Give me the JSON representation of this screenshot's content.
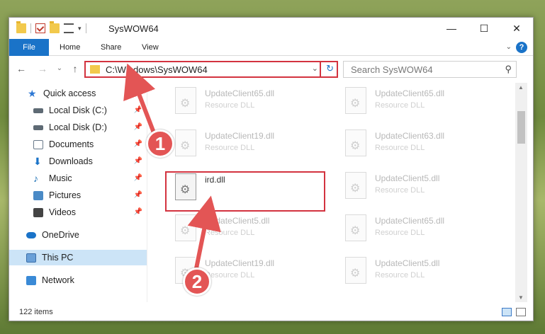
{
  "window": {
    "title": "SysWOW64",
    "minimize": "—",
    "maximize": "☐",
    "close": "✕"
  },
  "ribbon": {
    "tabs": [
      "File",
      "Home",
      "Share",
      "View"
    ],
    "expand_icon": "chevron-down-icon",
    "help": "?"
  },
  "nav": {
    "back": "←",
    "forward": "→",
    "dropdown": "⌄",
    "up": "↑",
    "address": "C:\\Windows\\SysWOW64",
    "address_dropdown": "⌄",
    "refresh": "↻",
    "search_placeholder": "Search SysWOW64"
  },
  "sidebar": {
    "items": [
      {
        "label": "Quick access",
        "icon": "star-icon",
        "pinned": false
      },
      {
        "label": "Local Disk (C:)",
        "icon": "disk-icon",
        "pinned": true
      },
      {
        "label": "Local Disk (D:)",
        "icon": "disk-icon",
        "pinned": true
      },
      {
        "label": "Documents",
        "icon": "documents-icon",
        "pinned": true
      },
      {
        "label": "Downloads",
        "icon": "downloads-icon",
        "pinned": true
      },
      {
        "label": "Music",
        "icon": "music-icon",
        "pinned": true
      },
      {
        "label": "Pictures",
        "icon": "pictures-icon",
        "pinned": true
      },
      {
        "label": "Videos",
        "icon": "videos-icon",
        "pinned": true
      },
      {
        "label": "OneDrive",
        "icon": "cloud-icon",
        "pinned": false
      },
      {
        "label": "This PC",
        "icon": "computer-icon",
        "pinned": false,
        "selected": true
      },
      {
        "label": "Network",
        "icon": "network-icon",
        "pinned": false
      }
    ]
  },
  "files": [
    {
      "name": "UpdateClient65.dll",
      "type": "Resource DLL"
    },
    {
      "name": "UpdateClient65.dll",
      "type": "Resource DLL"
    },
    {
      "name": "UpdateClient19.dll",
      "type": "Resource DLL"
    },
    {
      "name": "UpdateClient63.dll",
      "type": "Resource DLL"
    },
    {
      "name": "ird.dll",
      "type": ""
    },
    {
      "name": "UpdateClient5.dll",
      "type": "Resource DLL"
    },
    {
      "name": "UpdateClient5.dll",
      "type": "Resource DLL"
    },
    {
      "name": "UpdateClient65.dll",
      "type": "Resource DLL"
    },
    {
      "name": "UpdateClient19.dll",
      "type": "Resource DLL"
    },
    {
      "name": "UpdateClient5.dll",
      "type": "Resource DLL"
    }
  ],
  "status": {
    "item_count": "122 items"
  },
  "annotations": {
    "step1": "1",
    "step2": "2",
    "color": "#e35555"
  }
}
